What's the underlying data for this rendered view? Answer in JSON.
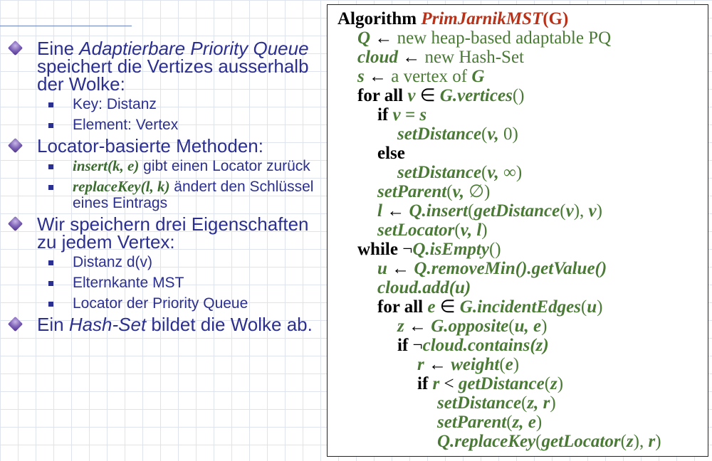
{
  "left": {
    "bullet1": {
      "pre": "Eine ",
      "it": "Adaptierbare Priority Queue",
      "post": " speichert die Vertizes ausserhalb der Wolke:"
    },
    "bullet1_sub": [
      "Key: Distanz",
      "Element: Vertex"
    ],
    "bullet2": "Locator-basierte Methoden:",
    "bullet2_sub": [
      {
        "code": "insert",
        "args": "(k, e)",
        "text": " gibt einen Locator zurück"
      },
      {
        "code": "replaceKey",
        "args": "(l, k)",
        "text": " ändert den Schlüssel eines Eintrags"
      }
    ],
    "bullet3": "Wir speichern drei Eigenschaften zu jedem Vertex:",
    "bullet3_sub": [
      "Distanz d(v)",
      "Elternkante MST",
      "Locator der Priority Queue"
    ],
    "bullet4": {
      "pre": "Ein ",
      "it": "Hash-Set",
      "post": " bildet die Wolke ab."
    }
  },
  "algorithm": {
    "kw_algorithm": "Algorithm",
    "name": "PrimJarnikMST",
    "param": "(G)",
    "l1a": "Q",
    "l1b": " ← ",
    "l1c": "new heap-based adaptable PQ",
    "l2a": "cloud",
    "l2b": " ← ",
    "l2c": "new Hash-Set",
    "l3a": "s",
    "l3b": " ← ",
    "l3c": " a vertex of ",
    "l3d": "G",
    "l4a": "for all",
    "l4b": "v",
    "l4c": " ∈ ",
    "l4d": "G.vertices",
    "l4e": "()",
    "l5a": "if",
    "l5b": "v = s",
    "l6a": "setDistance",
    "l6b": "(",
    "l6c": "v,",
    "l6d": " 0)",
    "l7": "else",
    "l8a": "setDistance",
    "l8b": "(",
    "l8c": "v,",
    "l8d": " ∞)",
    "l9a": "setParent",
    "l9b": "(",
    "l9c": "v,",
    "l9d": " ∅)",
    "l10a": "l",
    "l10b": " ← ",
    "l10c": "Q.insert",
    "l10d": "(",
    "l10e": "getDistance",
    "l10f": "(",
    "l10g": "v",
    "l10h": "), ",
    "l10i": "v",
    "l10j": ")",
    "l11a": "setLocator",
    "l11b": "(",
    "l11c": "v, l",
    "l11d": ")",
    "l12a": "while",
    "l12b": " ¬",
    "l12c": "Q.isEmpty",
    "l12d": "()",
    "l13a": "u",
    "l13b": " ← ",
    "l13c": "Q.removeMin().getValue()",
    "l14": "cloud.add(u)",
    "l15a": "for all",
    "l15b": "e",
    "l15c": " ∈ ",
    "l15d": "G.incidentEdges",
    "l15e": "(",
    "l15f": "u",
    "l15g": ")",
    "l16a": "z",
    "l16b": " ← ",
    "l16c": "G.opposite",
    "l16d": "(",
    "l16e": "u, e",
    "l16f": ")",
    "l17a": "if",
    "l17b": " ¬",
    "l17c": "cloud.contains(z)",
    "l18a": "r",
    "l18b": " ← ",
    "l18c": "weight",
    "l18d": "(",
    "l18e": "e",
    "l18f": ")",
    "l19a": "if",
    "l19b": "r",
    "l19c": " < ",
    "l19d": "getDistance",
    "l19e": "(",
    "l19f": "z",
    "l19g": ")",
    "l20a": "setDistance",
    "l20b": "(",
    "l20c": "z, r",
    "l20d": ")",
    "l21a": "setParent",
    "l21b": "(",
    "l21c": "z, e",
    "l21d": ")",
    "l22a": "Q.replaceKey",
    "l22b": "(",
    "l22c": "getLocator",
    "l22d": "(",
    "l22e": "z",
    "l22f": "), ",
    "l22g": "r",
    "l22h": ")"
  }
}
